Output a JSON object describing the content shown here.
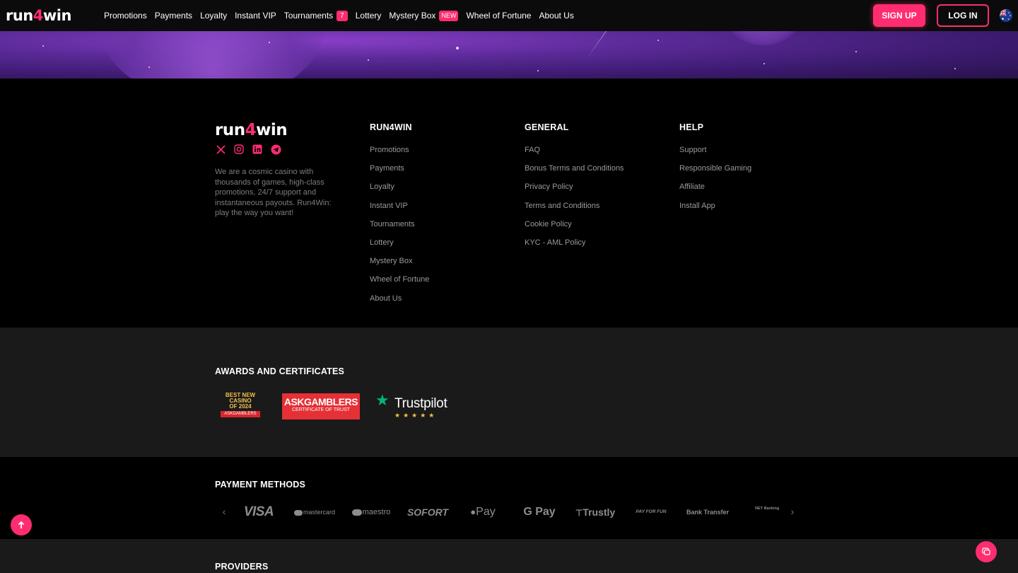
{
  "header": {
    "logo_pre": "run",
    "logo_four": "4",
    "logo_post": "win",
    "nav": [
      {
        "label": "Promotions"
      },
      {
        "label": "Payments"
      },
      {
        "label": "Loyalty"
      },
      {
        "label": "Instant VIP"
      },
      {
        "label": "Tournaments",
        "badge": "7"
      },
      {
        "label": "Lottery"
      },
      {
        "label": "Mystery Box",
        "badge": "NEW"
      },
      {
        "label": "Wheel of Fortune"
      },
      {
        "label": "About Us"
      }
    ],
    "signup_label": "SIGN UP",
    "login_label": "LOG IN",
    "language_icon": "australia-flag-icon"
  },
  "footer": {
    "logo_pre": "run",
    "logo_four": "4",
    "logo_post": "win",
    "socials": [
      "x-icon",
      "instagram-icon",
      "linkedin-icon",
      "telegram-icon"
    ],
    "about": "We are a cosmic casino with thousands of games, high-class promotions, 24/7 support and instantaneous payouts. Run4Win: play the way you want!",
    "columns": [
      {
        "title": "RUN4WIN",
        "links": [
          "Promotions",
          "Payments",
          "Loyalty",
          "Instant VIP",
          "Tournaments",
          "Lottery",
          "Mystery Box",
          "Wheel of Fortune",
          "About Us"
        ]
      },
      {
        "title": "GENERAL",
        "links": [
          "FAQ",
          "Bonus Terms and Conditions",
          "Privacy Policy",
          "Terms and Conditions",
          "Cookie Policy",
          "KYC - AML Policy"
        ]
      },
      {
        "title": "HELP",
        "links": [
          "Support",
          "Responsible Gaming",
          "Affiliate",
          "Install App"
        ]
      }
    ]
  },
  "awards": {
    "title": "AWARDS AND CERTIFICATES",
    "best_new_line1": "BEST NEW",
    "best_new_line2": "CASINO",
    "best_new_line3": "OF 2024",
    "best_new_ribbon": "ASKGAMBLERS",
    "askgamblers_name": "ASKGAMBLERS",
    "askgamblers_sub": "CERTIFICATE OF TRUST",
    "trustpilot_name": "Trustpilot",
    "trustpilot_stars": "★★★★★"
  },
  "payments": {
    "title": "PAYMENT METHODS",
    "methods": [
      "VISA",
      "mastercard",
      "maestro",
      "SOFORT",
      "Pay",
      "G Pay",
      "Trustly",
      "PAY FOR FUN",
      "Bank Transfer",
      "NET Banking"
    ]
  },
  "providers": {
    "title": "PROVIDERS"
  },
  "colors": {
    "accent": "#ff2d6f",
    "background": "#000000",
    "panel": "#1a1a1a"
  }
}
